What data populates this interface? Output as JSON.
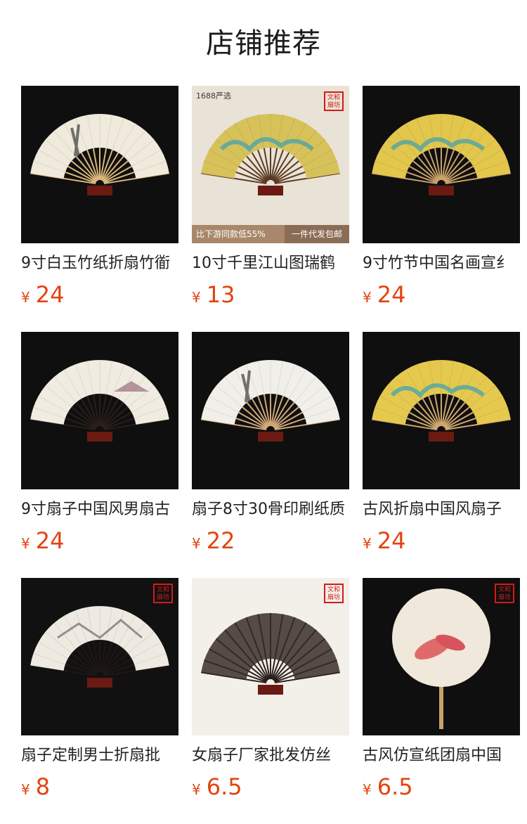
{
  "section": {
    "title": "店铺推荐"
  },
  "currency": "¥",
  "products": [
    {
      "name": "9寸白玉竹纸折扇竹衜",
      "price": "24",
      "bg": "#0f0f0f",
      "fan": "#efeadc",
      "ribs": "#d9b77c",
      "style": "bamboo"
    },
    {
      "name": "10寸千里江山图瑞鹤",
      "price": "13",
      "bg": "#e9e2d6",
      "fan": "#d7c25a",
      "ribs": "#5a3a22",
      "style": "landscape",
      "badge": "1688严选",
      "banner_left": "比下游同款低55%",
      "banner_right": "一件代发包邮",
      "seal": "文和扇坊"
    },
    {
      "name": "9寸竹节中国名画宣纟",
      "price": "24",
      "bg": "#0f0f0f",
      "fan": "#e3c64c",
      "ribs": "#caa26b",
      "style": "landscape"
    },
    {
      "name": "9寸扇子中国风男扇古",
      "price": "24",
      "bg": "#0f0f0f",
      "fan": "#f0ece2",
      "ribs": "#2a1f1a",
      "style": "pavilion"
    },
    {
      "name": "扇子8寸30骨印刷纸质",
      "price": "22",
      "bg": "#0f0f0f",
      "fan": "#f1efe9",
      "ribs": "#d2a87a",
      "style": "bamboo"
    },
    {
      "name": "古风折扇中国风扇子",
      "price": "24",
      "bg": "#0f0f0f",
      "fan": "#e5c94f",
      "ribs": "#cfa86f",
      "style": "landscape"
    },
    {
      "name": "扇子定制男士折扇批",
      "price": "8",
      "bg": "#111111",
      "fan": "#eeeae1",
      "ribs": "#1f1714",
      "style": "city",
      "seal": "文和扇坊"
    },
    {
      "name": "女扇子厂家批发仿丝",
      "price": "6.5",
      "bg": "#f3efe9",
      "fan": "#3a2e2a",
      "ribs": "#2a201c",
      "style": "silk",
      "seal": "文和扇坊"
    },
    {
      "name": "古风仿宣纸团扇中国",
      "price": "6.5",
      "bg": "#0f0f0f",
      "fan": "#f0e8da",
      "ribs": "#c9a26a",
      "style": "round",
      "seal": "文和扇坊"
    }
  ]
}
